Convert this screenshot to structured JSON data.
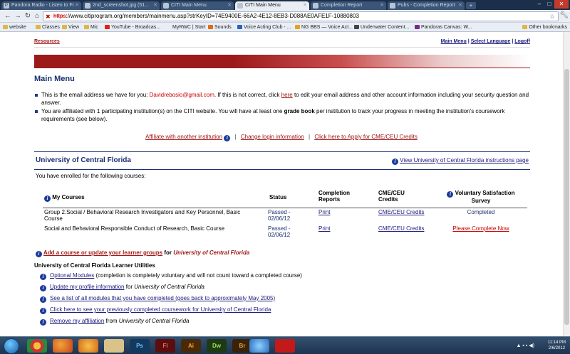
{
  "browser": {
    "tabs": [
      {
        "label": "Pandora Radio - Listen to Fr"
      },
      {
        "label": "2nd_screenshot.jpg (51..."
      },
      {
        "label": "CITI Main Menu"
      },
      {
        "label": "CITI Main Menu"
      },
      {
        "label": "Completion Report"
      },
      {
        "label": "Pubs - Completion Report"
      }
    ],
    "url_https": "https",
    "url_rest": "://www.citiprogram.org/members/mainmenu.asp?strKeyID=74E9400E-66A2-4E12-8EB3-D088AE0AFE1F-10880803",
    "bookmarks": [
      "website",
      "Classes",
      "View",
      "Mic",
      "YouTube - Broadcas...",
      "MyRWC | Start",
      "Sounds",
      "Voice Acting Club - ...",
      "NG BBS — Voice Act...",
      "Underwater Content...",
      "Pandoras Canvas: W..."
    ],
    "other_bookmarks": "Other bookmarks"
  },
  "top_nav": {
    "resources": "Resources",
    "main_menu": "Main Menu",
    "select_language": "Select Language",
    "logoff": "Logoff",
    "sep": "|"
  },
  "title": "Main Menu",
  "bullets": {
    "b1_pre": "This is the email address we have for you: ",
    "email": "Davidrebosio@gmail.com",
    "b1_mid": ". If this is not correct, click ",
    "here": "here",
    "b1_post": " to edit your email address and other account information including your security question and answer.",
    "b2_pre": "You are affiliated with 1 participating institution(s) on the CITI website. You will have at least one ",
    "grade_book": "grade book",
    "b2_post": " per institution to track your progress in meeting the institution's coursework requirements (see below)."
  },
  "actions": {
    "affiliate": "Affiliate with another institution",
    "change_login": "Change login information",
    "apply_cme": "Click here to Apply for CME/CEU Credits",
    "sep": "|"
  },
  "institution": {
    "name": "University of Central Florida",
    "instructions_link": "View University of Central Florida instructions page",
    "enrolled_text": "You have enrolled for the following courses:"
  },
  "table": {
    "headers": {
      "my_courses": "My Courses",
      "status": "Status",
      "completion_reports_1": "Completion",
      "completion_reports_2": "Reports",
      "cme_1": "CME/CEU",
      "cme_2": "Credits",
      "voluntary_1": "Voluntary Satisfaction",
      "voluntary_2": "Survey"
    },
    "rows": [
      {
        "course_1": "Group 2.Social / Behavioral Research Investigators and Key Personnel, Basic",
        "course_2": "Course",
        "status_1": "Passed -",
        "status_2": "02/06/12",
        "report": "Print",
        "cme": "CME/CEU Credits",
        "survey": "Completed"
      },
      {
        "course_1": "Social and Behavioral Responsible Conduct of Research, Basic Course",
        "course_2": "",
        "status_1": "Passed -",
        "status_2": "02/06/12",
        "report": "Print",
        "cme": "CME/CEU Credits",
        "survey": "Please Complete Now"
      }
    ]
  },
  "add_course": {
    "link": "Add a course or update your learner groups",
    "for": " for ",
    "institution": "University of Central Florida"
  },
  "utilities": {
    "heading": "University of Central Florida Learner Utilities",
    "items": [
      {
        "link": "Optional Modules",
        "rest": " (completion is completely voluntary and will not count toward a completed course)"
      },
      {
        "link": "Update my profile information",
        "rest": " for ",
        "italic": "University of Central Florida"
      },
      {
        "link": "See a list of all modules that you have completed (goes back to approximately May 2005)",
        "rest": ""
      },
      {
        "link": "Click here to see your previously completed coursework for University of Central Florida",
        "rest": ""
      },
      {
        "link": "Remove my affiliation",
        "rest": " from ",
        "italic": "University of Central Florida"
      }
    ]
  },
  "taskbar": {
    "apps": [
      "Ps",
      "Fl",
      "Ai",
      "Dw",
      "Br"
    ],
    "time": "11:14 PM",
    "date": "2/6/2012"
  },
  "colors": {
    "brand_red": "#9c1a1a",
    "heading_blue": "#1a2f6e",
    "link_blue": "#1a1a7a",
    "alert_red": "#cc0000"
  }
}
